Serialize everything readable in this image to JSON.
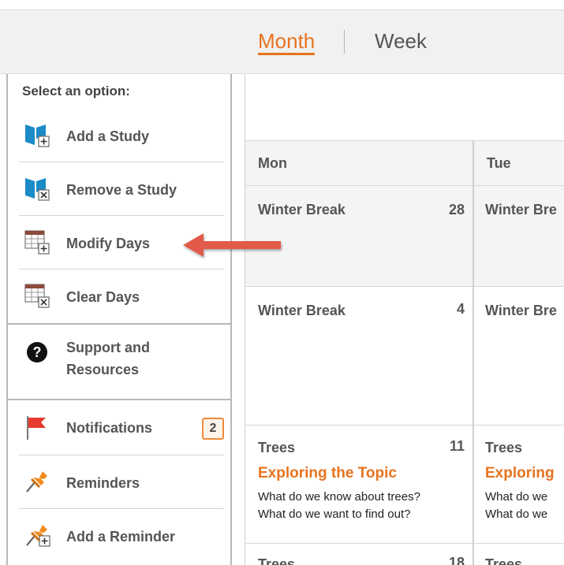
{
  "view_switch": {
    "month": "Month",
    "week": "Week",
    "active": "Month"
  },
  "panel": {
    "title": "Select an option:",
    "options": [
      {
        "label": "Add a Study",
        "icon": "book-add-icon"
      },
      {
        "label": "Remove a Study",
        "icon": "book-remove-icon"
      },
      {
        "label": "Modify Days",
        "icon": "calendar-add-icon"
      },
      {
        "label": "Clear Days",
        "icon": "calendar-remove-icon"
      }
    ],
    "support": {
      "label_line1": "Support and",
      "label_line2": "Resources",
      "icon": "question-circle-icon"
    },
    "notify": [
      {
        "label": "Notifications",
        "icon": "flag-icon",
        "badge": "2"
      },
      {
        "label": "Reminders",
        "icon": "pushpin-icon"
      },
      {
        "label": "Add a Reminder",
        "icon": "pushpin-add-icon"
      }
    ]
  },
  "calendar": {
    "days": [
      "Mon",
      "Tue"
    ],
    "weeks": [
      {
        "mon": {
          "name": "Winter Break",
          "num": "28"
        },
        "tue": {
          "name": "Winter Bre"
        }
      },
      {
        "mon": {
          "name": "Winter Break",
          "num": "4"
        },
        "tue": {
          "name": "Winter Bre"
        }
      },
      {
        "mon": {
          "name": "Trees",
          "num": "11",
          "sub": "Exploring the Topic",
          "q1": "What do we know about trees?",
          "q2": "What do we want to find out?"
        },
        "tue": {
          "name": "Trees",
          "sub": "Exploring",
          "q1": "What do we",
          "q2": "What do we"
        }
      },
      {
        "mon": {
          "name": "Trees",
          "num": "18"
        },
        "tue": {
          "name": "Trees"
        }
      }
    ]
  },
  "colors": {
    "accent": "#e8731e",
    "book": "#1a8bc7",
    "arrow": "#e25a4a",
    "flag": "#e63a2e",
    "pin": "#f28c1e"
  }
}
